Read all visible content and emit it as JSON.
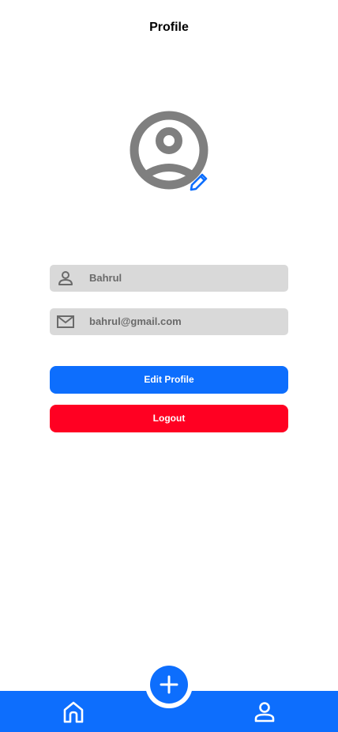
{
  "header": {
    "title": "Profile"
  },
  "profile": {
    "name": "Bahrul",
    "email": "bahrul@gmail.com"
  },
  "buttons": {
    "edit_label": "Edit Profile",
    "logout_label": "Logout"
  },
  "icons": {
    "avatar": "account-circle-icon",
    "edit_avatar": "pencil-icon",
    "name_field": "person-icon",
    "email_field": "mail-icon",
    "fab": "plus-icon",
    "nav_home": "home-icon",
    "nav_profile": "person-icon"
  },
  "colors": {
    "primary": "#0d6efd",
    "danger": "#ff0022",
    "field_bg": "#d9d9d9",
    "icon_gray": "#7f7f7f"
  }
}
